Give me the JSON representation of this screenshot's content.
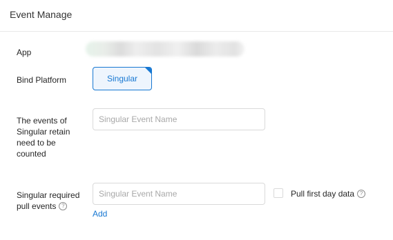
{
  "header": {
    "title": "Event Manage"
  },
  "form": {
    "app_label": "App",
    "bind_platform_label": "Bind Platform",
    "platform_option": "Singular",
    "retain_events_label": [
      "The events of",
      "Singular retain",
      "need to be",
      "counted"
    ],
    "retain_events_placeholder": "Singular Event Name",
    "pull_events_label_line1": "Singular required",
    "pull_events_label_line2": "pull events",
    "pull_events_placeholder": "Singular Event Name",
    "pull_first_day_label": "Pull first day data",
    "add_label": "Add",
    "help_glyph": "?"
  },
  "colors": {
    "accent": "#1677d2",
    "selected_bg": "#eef5fd",
    "border": "#d9d9d9",
    "placeholder": "#a8a8a8"
  },
  "icons": [
    "help-icon",
    "selected-corner-icon"
  ]
}
